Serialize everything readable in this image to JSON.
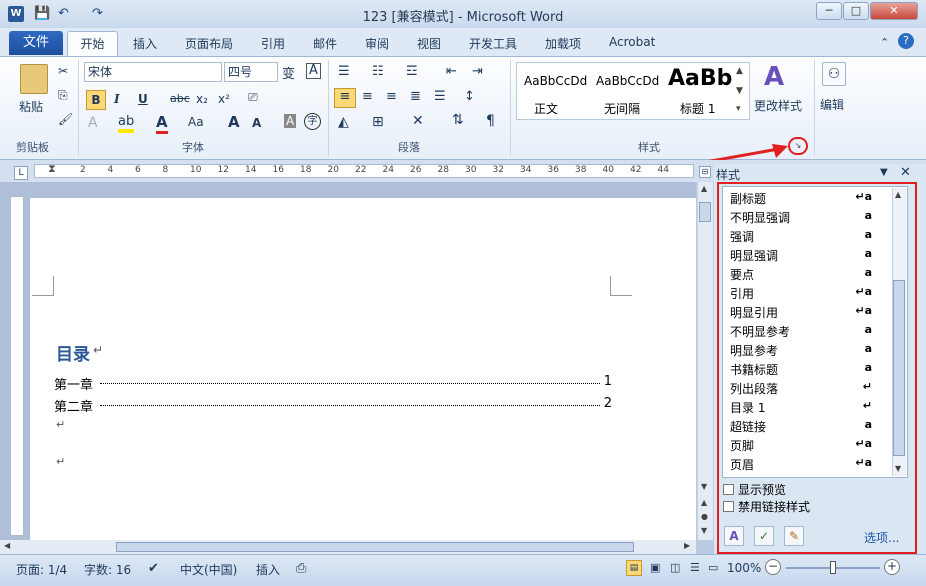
{
  "window": {
    "title": "123 [兼容模式] - Microsoft Word",
    "app_icon": "W",
    "min": "─",
    "max": "□",
    "close": "✕"
  },
  "qat": {
    "save": "💾",
    "undo": "↶",
    "redo": "↷"
  },
  "tabs": {
    "file": "文件",
    "items": [
      "开始",
      "插入",
      "页面布局",
      "引用",
      "邮件",
      "审阅",
      "视图",
      "开发工具",
      "加载项",
      "Acrobat"
    ]
  },
  "ribbon": {
    "clipboard": {
      "label": "剪贴板",
      "paste": "粘贴"
    },
    "font": {
      "label": "字体",
      "name": "宋体",
      "size": "四号",
      "bold": "B",
      "italic": "I",
      "underline": "U",
      "strike": "abc",
      "sub": "x₂",
      "sup": "x²",
      "color": "A",
      "case": "Aa",
      "grow": "A",
      "shrink": "A"
    },
    "paragraph": {
      "label": "段落"
    },
    "styles": {
      "label": "样式",
      "items": [
        {
          "preview": "AaBbCcDd",
          "name": "正文"
        },
        {
          "preview": "AaBbCcDd",
          "name": "无间隔"
        },
        {
          "preview": "AaBb",
          "name": "标题 1"
        }
      ],
      "change": "更改样式"
    },
    "editing": {
      "label": "编辑"
    }
  },
  "ruler": {
    "marks": [
      "2",
      "4",
      "6",
      "8",
      "10",
      "12",
      "14",
      "16",
      "18",
      "20",
      "22",
      "24",
      "26",
      "28",
      "30",
      "32",
      "34",
      "36",
      "38",
      "40",
      "42",
      "44"
    ]
  },
  "document": {
    "heading": "目录",
    "toc": [
      {
        "text": "第一章",
        "page": "1"
      },
      {
        "text": "第二章",
        "page": "2"
      }
    ],
    "para_mark": "↵"
  },
  "styles_pane": {
    "title": "样式",
    "items": [
      {
        "name": "副标题",
        "mark": "↵a"
      },
      {
        "name": "不明显强调",
        "mark": "a"
      },
      {
        "name": "强调",
        "mark": "a"
      },
      {
        "name": "明显强调",
        "mark": "a"
      },
      {
        "name": "要点",
        "mark": "a"
      },
      {
        "name": "引用",
        "mark": "↵a"
      },
      {
        "name": "明显引用",
        "mark": "↵a"
      },
      {
        "name": "不明显参考",
        "mark": "a"
      },
      {
        "name": "明显参考",
        "mark": "a"
      },
      {
        "name": "书籍标题",
        "mark": "a"
      },
      {
        "name": "列出段落",
        "mark": "↵"
      },
      {
        "name": "目录 1",
        "mark": "↵"
      },
      {
        "name": "超链接",
        "mark": "a"
      },
      {
        "name": "页脚",
        "mark": "↵a"
      },
      {
        "name": "页眉",
        "mark": "↵a"
      }
    ],
    "show_preview": "显示预览",
    "disable_linked": "禁用链接样式",
    "options": "选项..."
  },
  "status": {
    "page": "页面: 1/4",
    "words": "字数: 16",
    "lang": "中文(中国)",
    "mode": "插入",
    "zoom": "100%"
  },
  "colors": {
    "accent": "#2b579a",
    "highlight": "#e02020"
  }
}
